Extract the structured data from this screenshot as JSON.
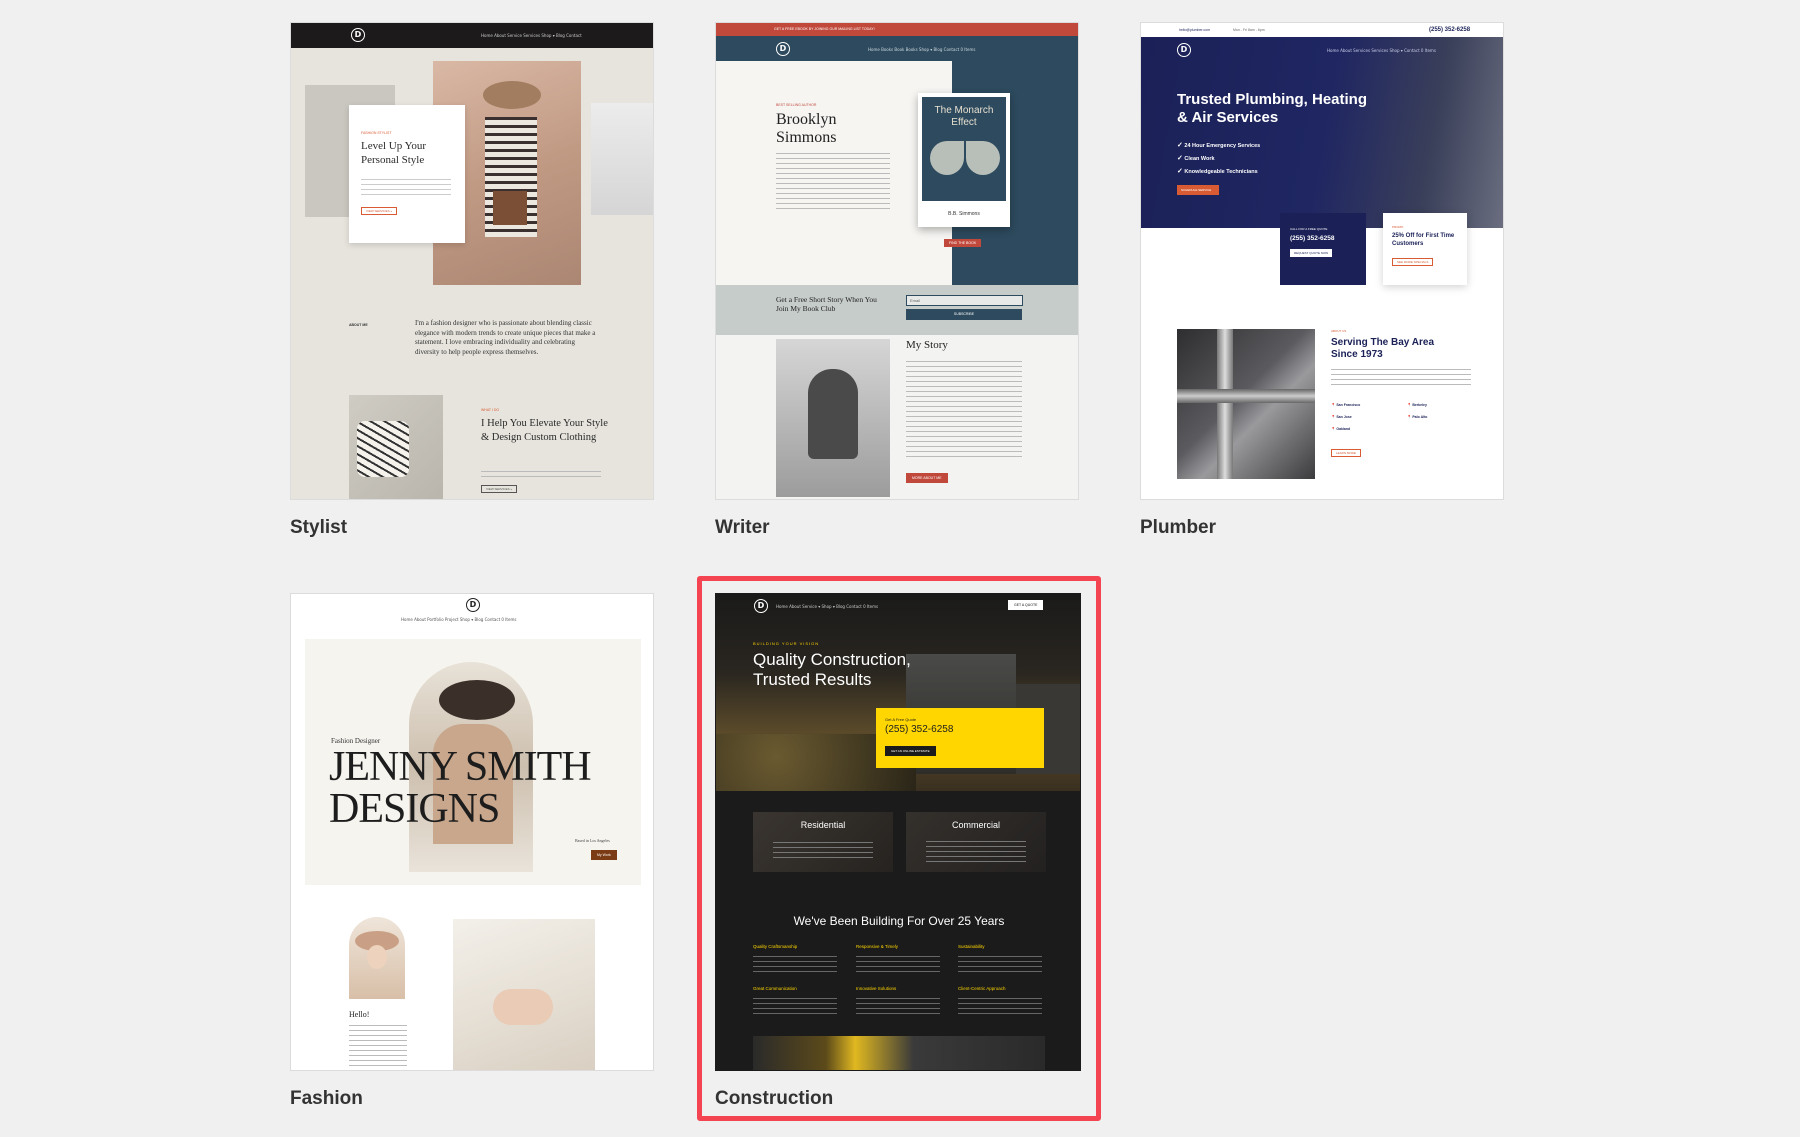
{
  "theme": {
    "background": "#f0f0f0",
    "highlight": "#f44452",
    "accent_orange": "#d95b33",
    "accent_yellow": "#ffd600",
    "plumber_navy": "#1b2157"
  },
  "cards": {
    "stylist": {
      "label": "Stylist",
      "logo": "D",
      "nav": "Home   About   Service   Services   Shop ▾   Blog   Contact",
      "kicker": "FASHION STYLIST",
      "headline": "Level Up Your Personal Style",
      "about_label": "ABOUT ME",
      "about_text": "I'm a fashion designer who is passionate about blending classic elegance with modern trends to create unique pieces that make a statement. I love embracing individuality and celebrating diversity to help people express themselves.",
      "what_label": "WHAT I DO",
      "help_headline": "I Help You Elevate Your Style & Design Custom Clothing",
      "button": "VIEW SERVICES »"
    },
    "writer": {
      "label": "Writer",
      "topbar": "GET A FREE EBOOK BY JOINING OUR MAILING LIST TODAY!",
      "logo": "D",
      "nav": "Home   Books   Book   Books   Shop ▾   Blog   Contact   0 Items",
      "kicker": "BEST SELLING AUTHOR",
      "name": "Brooklyn Simmons",
      "book_title": "The Monarch Effect",
      "book_author": "B.B. Simmons",
      "book_button": "FIND THE BOOK",
      "newsletter": "Get a Free Short Story When You Join My Book Club",
      "email_placeholder": "Email",
      "subscribe": "SUBSCRIBE",
      "story_title": "My Story",
      "story_button": "MORE ABOUT ME"
    },
    "plumber": {
      "label": "Plumber",
      "email": "hello@plumber.com",
      "hours": "Mon - Fri 8am - 6pm",
      "phone": "(255) 352-6258",
      "logo": "D",
      "nav": "Home   About   Services   Services   Shop ▾   Contact   0 Items",
      "headline": "Trusted Plumbing, Heating & Air Services",
      "checks": [
        "24 Hour Emergency Services",
        "Clean Work",
        "Knowledgeable Technicians"
      ],
      "cta": "SCHEDULE SERVICE",
      "call_label": "CALL FOR A FREE QUOTE",
      "call_phone": "(255) 352-6258",
      "call_button": "REQUEST QUOTE NOW",
      "promo_kicker": "PROMO",
      "promo_title": "25% Off for First Time Customers",
      "promo_button": "SEE MORE SPECIALS",
      "about_kicker": "ABOUT US",
      "about_title": "Serving The Bay Area Since 1973",
      "cities": [
        "San Francisco",
        "Berkeley",
        "San Jose",
        "Palo Alto",
        "Oakland"
      ],
      "about_button": "LEARN MORE"
    },
    "fashion": {
      "label": "Fashion",
      "logo": "D",
      "nav": "Home   About   Portfolio   Project   Shop ▾   Blog   Contact   0 Items",
      "kicker": "Fashion Designer",
      "headline_1": "JENNY SMITH",
      "headline_2": "DESIGNS",
      "location": "Based in Los Angeles",
      "button": "My Work",
      "hello": "Hello!"
    },
    "construction": {
      "label": "Construction",
      "logo": "D",
      "nav": "Home   About   Service ▾   Shop ▾   Blog   Contact   0 Items",
      "quote_button": "GET A QUOTE",
      "kicker": "BUILDING YOUR VISION",
      "headline_1": "Quality Construction,",
      "headline_2": "Trusted Results",
      "free_quote_label": "Get A Free Quote",
      "phone": "(255) 352-6258",
      "estimate_button": "GET AN ONLINE ESTIMATE",
      "service_1": "Residential",
      "service_2": "Commercial",
      "years_title": "We've Been Building For Over 25 Years",
      "features": [
        "Quality Craftsmanship",
        "Responsive & Timely",
        "Sustainability",
        "Great Communication",
        "Innovative Solutions",
        "Client-Centric Approach"
      ]
    }
  }
}
